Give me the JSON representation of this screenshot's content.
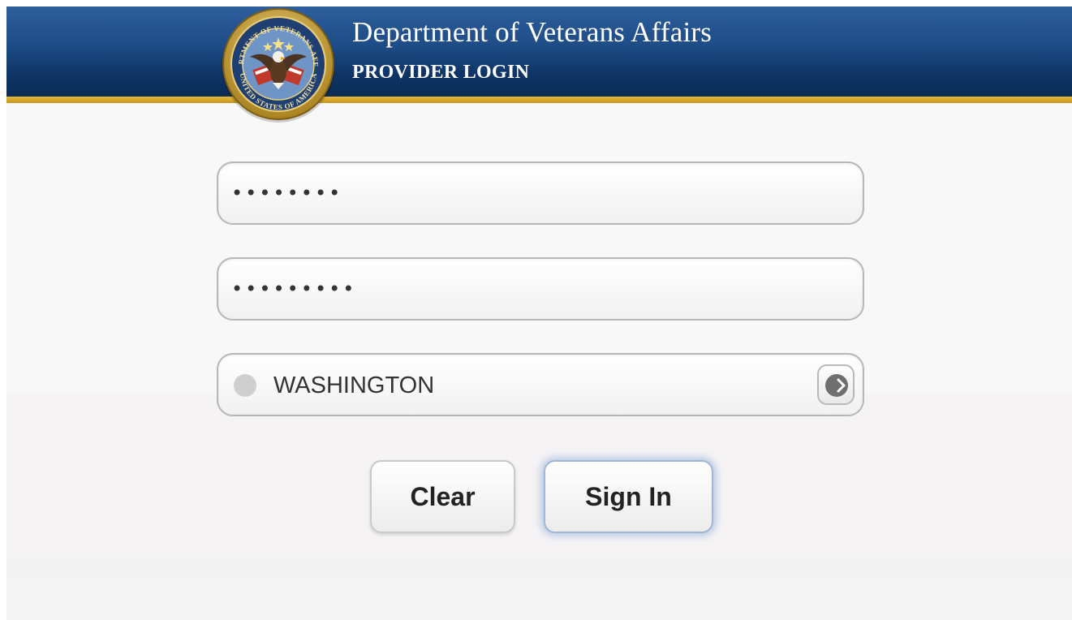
{
  "header": {
    "title": "Department of Veterans Affairs",
    "subtitle": "PROVIDER LOGIN",
    "seal": {
      "top_text": "DEPARTMENT OF VETERANS AFFAIRS",
      "bottom_text": "UNITED STATES OF AMERICA",
      "icon": "eagle-seal-icon"
    }
  },
  "form": {
    "username_value": "••••••••",
    "password_value": "•••••••••",
    "site": {
      "selected": "WASHINGTON"
    }
  },
  "buttons": {
    "clear_label": "Clear",
    "signin_label": "Sign In"
  },
  "colors": {
    "header_blue": "#1d4b85",
    "gold_stripe": "#d9a92c",
    "background": "#f8f8f8",
    "focus_glow": "#7aa0d2"
  }
}
